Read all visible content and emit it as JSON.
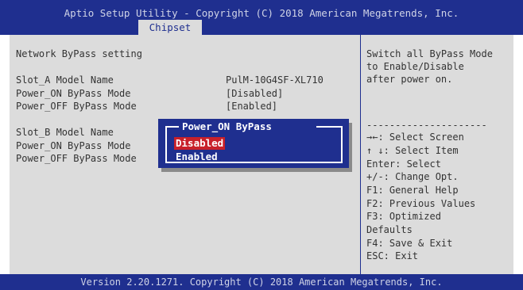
{
  "header": {
    "title": "Aptio Setup Utility - Copyright (C) 2018 American Megatrends, Inc.",
    "active_tab": "Chipset"
  },
  "main": {
    "section_title": "Network ByPass setting",
    "slot_a": {
      "model_label": "Slot_A Model Name",
      "model_value": "PulM-10G4SF-XL710",
      "power_on_label": "Power_ON ByPass Mode",
      "power_on_value": "[Disabled]",
      "power_off_label": "Power_OFF ByPass Mode",
      "power_off_value": "[Enabled]"
    },
    "slot_b": {
      "model_label": "Slot_B Model Name",
      "power_on_label": "Power_ON ByPass Mode",
      "power_off_label": "Power_OFF ByPass Mode"
    }
  },
  "popup": {
    "title": "Power_ON ByPass",
    "options": [
      "Disabled",
      "Enabled"
    ],
    "selected": "Disabled"
  },
  "help": {
    "description": [
      "Switch all ByPass Mode",
      "to Enable/Disable",
      "after power on."
    ],
    "separator": "---------------------",
    "keys": [
      "→←: Select Screen",
      "↑ ↓: Select Item",
      "Enter: Select",
      "+/-: Change Opt.",
      "F1:  General Help",
      "F2:  Previous Values",
      "F3:  Optimized",
      "Defaults",
      "F4:  Save & Exit",
      "ESC: Exit"
    ]
  },
  "footer": {
    "version": "Version 2.20.1271. Copyright (C) 2018 American Megatrends, Inc."
  },
  "colors": {
    "bar_blue": "#1f2f8f",
    "panel_gray": "#dcdcdc",
    "highlight_red": "#c8202a"
  }
}
